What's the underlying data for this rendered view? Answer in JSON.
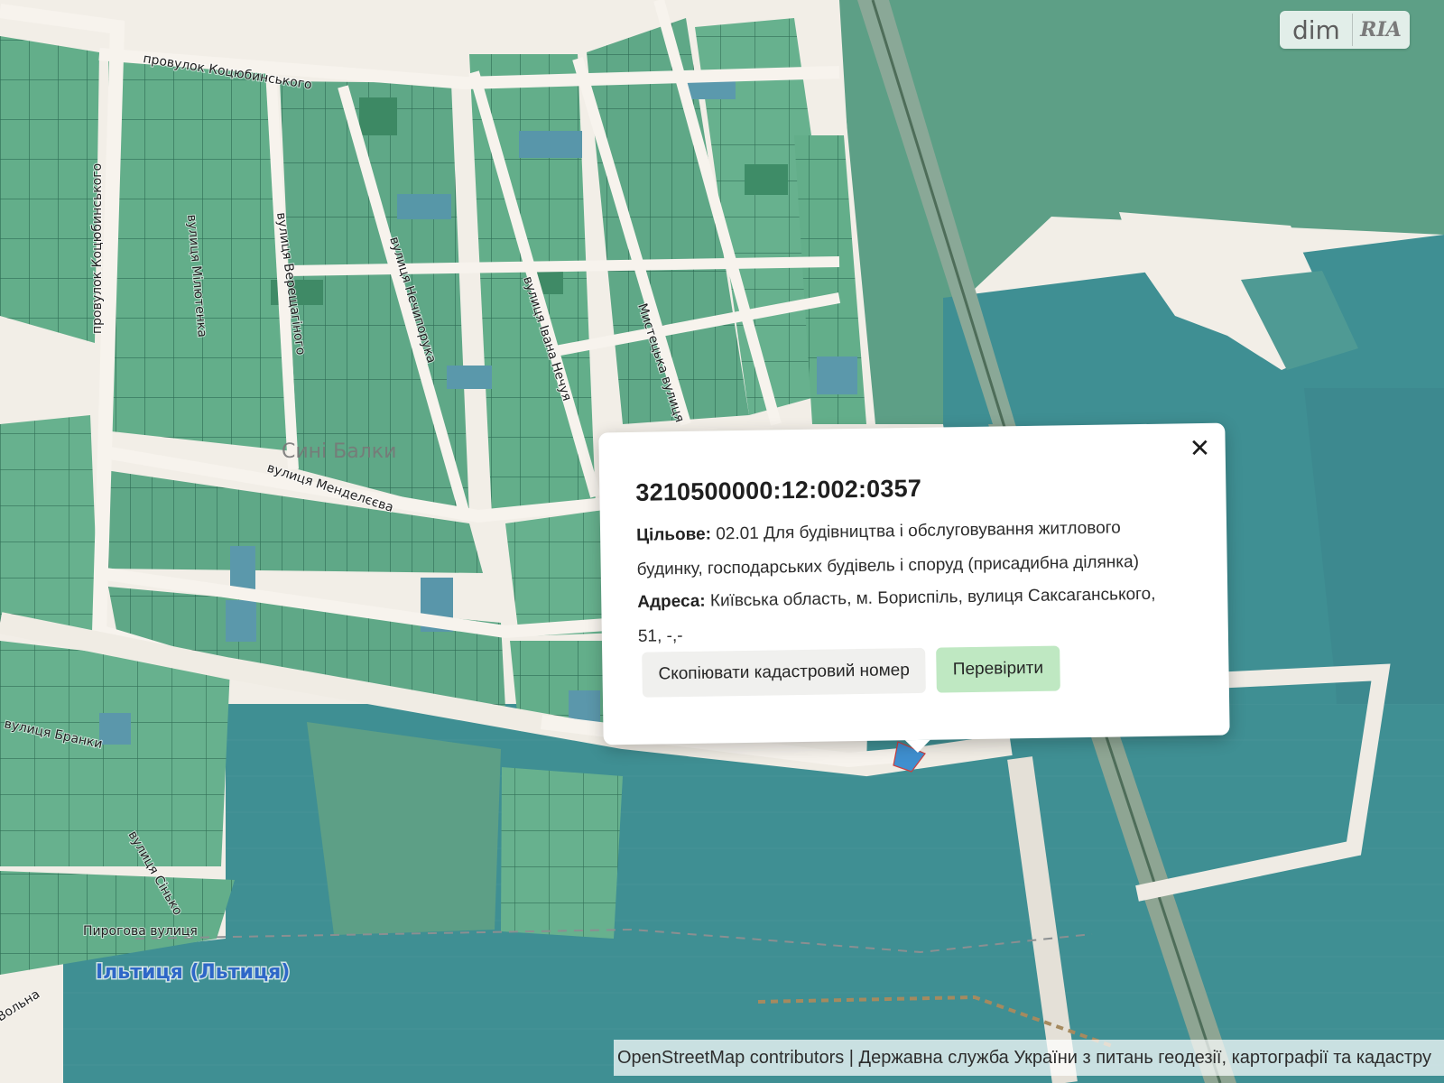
{
  "map": {
    "street_labels": [
      "провулок Коцюбинського",
      "провулок Коцюбинського",
      "вулиця Мілютенка",
      "вулиця Верещагіного",
      "вулиця Нечипорука",
      "вулиця Івана Нечуя",
      "Мистецька вулиця",
      "вулиця Менделєєва",
      "вулиця Бранки",
      "вулиця Сінько",
      "Пирогова вулиця",
      "Вольна"
    ],
    "district_label": "Сині Балки",
    "water_label": "Ільтиця (Льтиця)"
  },
  "watermark": {
    "left_text": "dim",
    "right_text": "RIA"
  },
  "popup": {
    "close_glyph": "✕",
    "cadastral_number": "3210500000:12:002:0357",
    "purpose_key": "Цільове:",
    "purpose_value": "02.01 Для будівництва і обслуговування житлового будинку, господарських будівель і споруд (присадибна ділянка)",
    "address_key": "Адреса:",
    "address_value": "Київська область, м. Бориспіль, вулиця Саксаганського, 51, -,-",
    "copy_button": "Скопіювати кадастровий номер",
    "check_button": "Перевірити"
  },
  "attribution": {
    "text": "OpenStreetMap contributors | Державна служба України з питань геодезії, картографії та кадастру"
  },
  "colors": {
    "road": "#f2eee7",
    "parcel": "#5faa86",
    "parcel_alt": "#6cb893",
    "water": "#3f8e92",
    "water_light": "#4e9f9d",
    "field": "#5d9f86",
    "label_blue": "#2e67c8"
  }
}
